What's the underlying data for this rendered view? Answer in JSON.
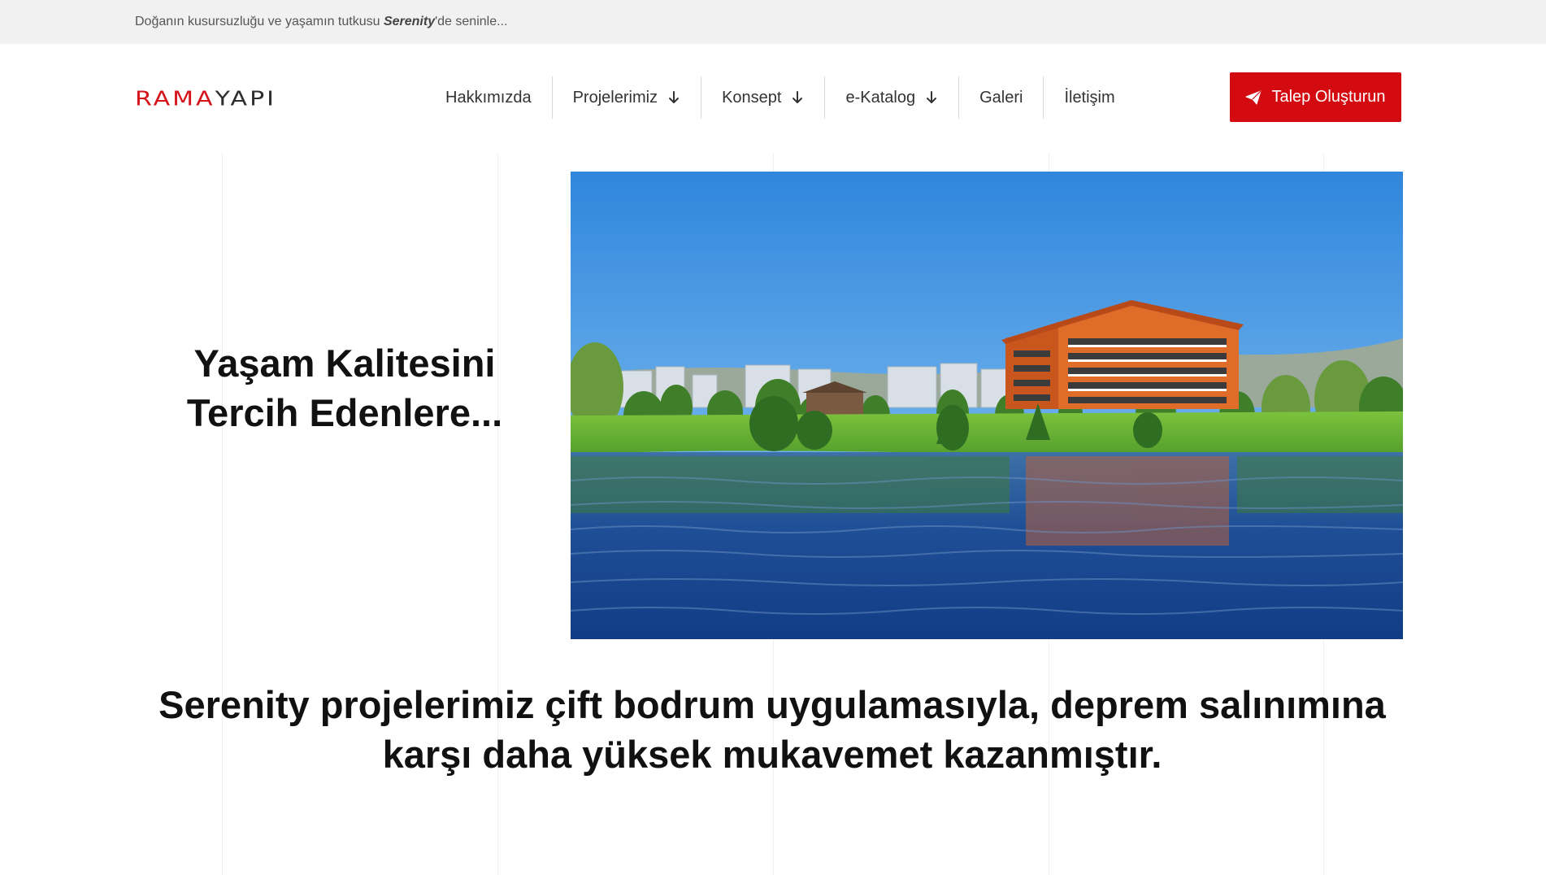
{
  "topbar": {
    "text_before": "Doğanın kusursuzluğu ve yaşamın tutkusu ",
    "brand": "Serenity",
    "text_after": "'de seninle..."
  },
  "header": {
    "logo_part_1": "RAMA",
    "logo_part_2": "YAPI",
    "nav": [
      {
        "label": "Hakkımızda",
        "has_dropdown": false
      },
      {
        "label": "Projelerimiz",
        "has_dropdown": true
      },
      {
        "label": "Konsept",
        "has_dropdown": true
      },
      {
        "label": "e-Katalog",
        "has_dropdown": true
      },
      {
        "label": "Galeri",
        "has_dropdown": false
      },
      {
        "label": "İletişim",
        "has_dropdown": false
      }
    ],
    "cta_label": "Talep Oluşturun",
    "cta_icon": "paper-plane-icon"
  },
  "hero": {
    "title_line_1": "Yaşam Kalitesini",
    "title_line_2": "Tercih Edenlere..."
  },
  "statement": {
    "line_1": "Serenity projelerimiz çift bodrum uygulamasıyla, deprem salınımına",
    "line_2": "karşı daha yüksek mukavemet kazanmıştır."
  },
  "colors": {
    "brand_red": "#d30a10",
    "topbar_bg": "#f1f1f1",
    "text_dark": "#111111"
  }
}
